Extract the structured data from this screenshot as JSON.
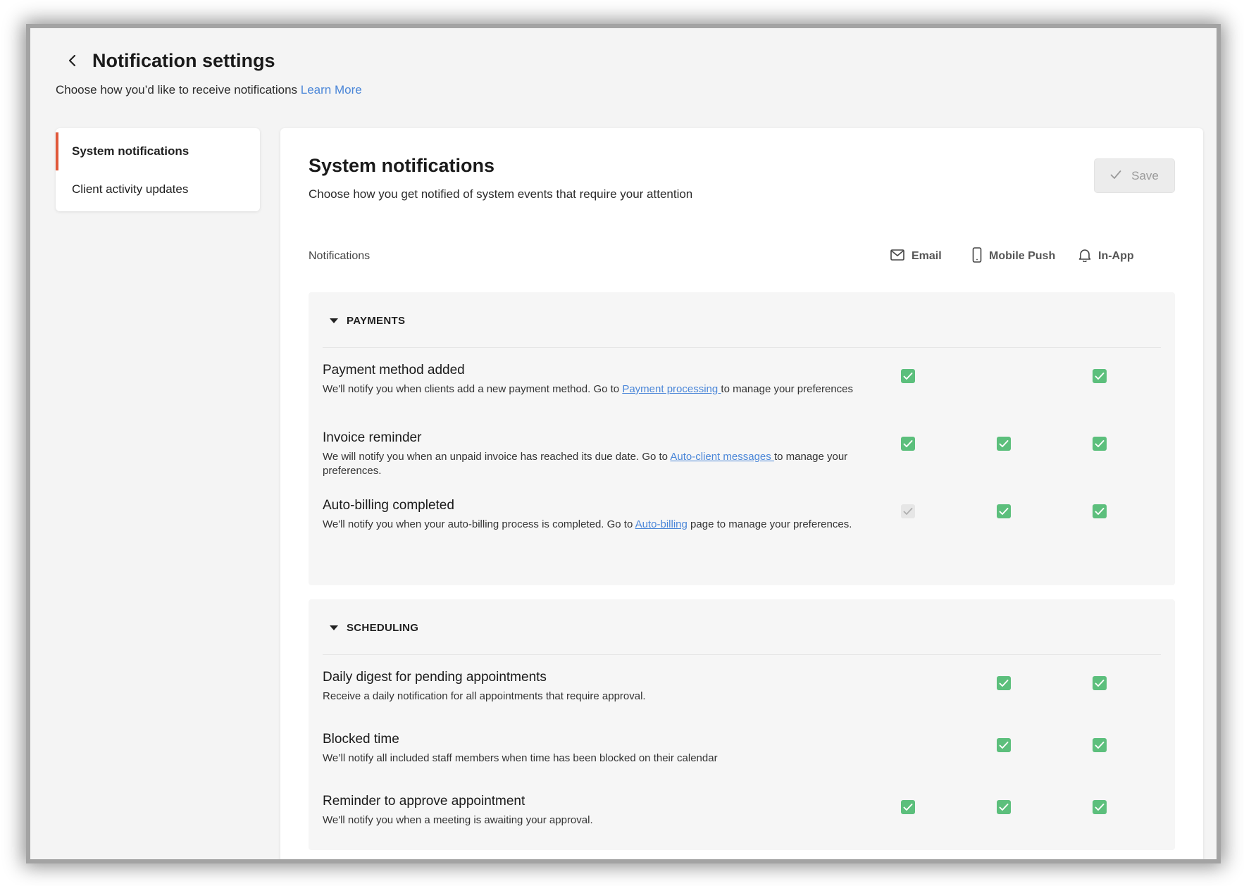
{
  "header": {
    "title": "Notification settings",
    "subtitle": "Choose how you’d like to receive notifications",
    "learn_more": "Learn More"
  },
  "sidebar": {
    "items": [
      {
        "label": "System notifications",
        "active": true
      },
      {
        "label": "Client activity updates",
        "active": false
      }
    ]
  },
  "main": {
    "title": "System notifications",
    "description": "Choose how you get notified of system events that require your attention",
    "save_label": "Save",
    "columns": {
      "notifications": "Notifications",
      "email": "Email",
      "push": "Mobile Push",
      "inapp": "In-App"
    }
  },
  "sections": {
    "payments": {
      "label": "PAYMENTS",
      "rows": [
        {
          "title": "Payment method added",
          "desc_before": "We'll notify you when clients add a new payment method. Go to ",
          "link": "Payment processing ",
          "desc_after": "to manage your preferences",
          "email": "checked",
          "push": "none",
          "inapp": "checked"
        },
        {
          "title": "Invoice reminder",
          "desc_before": "We will notify you when an unpaid invoice has reached its due date. Go to ",
          "link": "Auto-client messages ",
          "desc_after": "to manage your preferences.",
          "email": "checked",
          "push": "checked",
          "inapp": "checked"
        },
        {
          "title": "Auto-billing completed",
          "desc_before": "We'll notify you when your auto-billing process is completed. Go to ",
          "link": "Auto-billing",
          "desc_after": " page to manage your preferences.",
          "email": "checked-disabled",
          "push": "checked",
          "inapp": "checked"
        }
      ]
    },
    "scheduling": {
      "label": "SCHEDULING",
      "rows": [
        {
          "title": "Daily digest for pending appointments",
          "desc": "Receive a daily notification for all appointments that require approval.",
          "email": "none",
          "push": "checked",
          "inapp": "checked"
        },
        {
          "title": "Blocked time",
          "desc": "We’ll notify all included staff members when time has been blocked on their calendar",
          "email": "none",
          "push": "checked",
          "inapp": "checked"
        },
        {
          "title": "Reminder to approve appointment",
          "desc": "We'll notify you when a meeting is awaiting your approval.",
          "email": "checked",
          "push": "checked",
          "inapp": "checked"
        }
      ]
    }
  },
  "colors": {
    "accent": "#e0583a",
    "link": "#4a86d8",
    "checkbox": "#5cbf7c",
    "checkbox_disabled": "#e6e6e6"
  }
}
